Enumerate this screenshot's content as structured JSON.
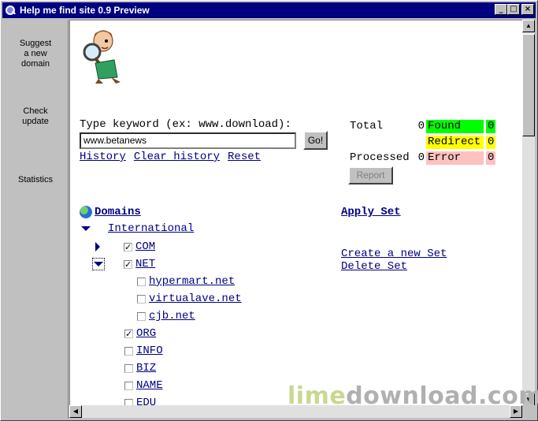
{
  "window": {
    "title": "Help me find site 0.9 Preview"
  },
  "sidebar": {
    "items": [
      {
        "label": "Suggest a new domain"
      },
      {
        "label": "Check update"
      },
      {
        "label": "Statistics"
      }
    ]
  },
  "search": {
    "label": "Type keyword (ex: www.download):",
    "value": "www.betanews",
    "go_label": "Go!",
    "history_label": "History",
    "clear_history_label": "Clear history",
    "reset_label": "Reset"
  },
  "stats": {
    "total_label": "Total",
    "total_value": "0",
    "processed_label": "Processed",
    "processed_value": "0",
    "found_label": "Found",
    "found_value": "0",
    "redirect_label": "Redirect",
    "redirect_value": "0",
    "error_label": "Error",
    "error_value": "0",
    "report_label": "Report",
    "colors": {
      "found": "#00ff00",
      "redirect": "#ffff00",
      "error": "#ffc0c0"
    }
  },
  "tree": {
    "root_label": "Domains",
    "group_label": "International",
    "items": [
      {
        "label": "COM",
        "checked": true
      },
      {
        "label": "NET",
        "checked": true
      },
      {
        "label": "hypermart.net",
        "checked": false
      },
      {
        "label": "virtualave.net",
        "checked": false
      },
      {
        "label": "cjb.net",
        "checked": false
      },
      {
        "label": "ORG",
        "checked": true
      },
      {
        "label": "INFO",
        "checked": false
      },
      {
        "label": "BIZ",
        "checked": false
      },
      {
        "label": "NAME",
        "checked": false
      },
      {
        "label": "EDU",
        "checked": false
      }
    ]
  },
  "sets": {
    "apply_label": "Apply Set",
    "create_label": "Create a new Set",
    "delete_label": "Delete Set"
  },
  "watermark": {
    "part1": "lime",
    "part2": "download",
    "part3": ".com",
    "colors": {
      "lime": "#c8d890",
      "download": "#b0b0b0"
    }
  }
}
